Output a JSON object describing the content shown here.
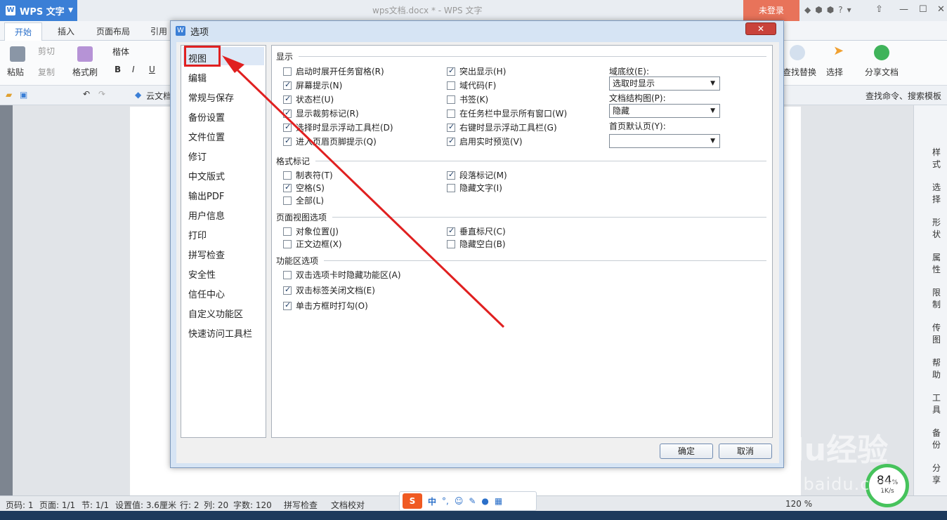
{
  "app": {
    "name": "WPS 文字",
    "logo": "W",
    "doc_title": "wps文档.docx * - WPS 文字",
    "login": "未登录"
  },
  "ribbon_tabs": [
    "开始",
    "插入",
    "页面布局",
    "引用"
  ],
  "ribbon": {
    "paste": "粘贴",
    "cut": "剪切",
    "copy": "复制",
    "format_painter": "格式刷",
    "font_name": "楷体",
    "find_replace": "查找替换",
    "select": "选择",
    "share": "分享文档",
    "cloud_doc": "云文档",
    "search_command": "查找命令、搜索模板"
  },
  "right_panel": [
    "样式",
    "选择",
    "形状",
    "属性",
    "限制",
    "传图",
    "帮助",
    "工具",
    "备份",
    "分享"
  ],
  "status": {
    "page_no": "页码: 1",
    "page_count": "页面: 1/1",
    "section": "节: 1/1",
    "setting": "设置值: 3.6厘米",
    "row": "行: 2",
    "col": "列: 20",
    "words": "字数: 120",
    "spell": "拼写检查",
    "proof": "文档校对",
    "zoom": "120 %"
  },
  "ime": {
    "logo": "S",
    "mode": "中"
  },
  "net": {
    "percent": "84",
    "unit": "%",
    "speed": "1K/s"
  },
  "watermark": {
    "main": "Baidu经验",
    "url": "jingyan.baidu.com"
  },
  "dialog": {
    "title": "选项",
    "logo": "W",
    "nav_items": [
      "视图",
      "编辑",
      "常规与保存",
      "备份设置",
      "文件位置",
      "修订",
      "中文版式",
      "输出PDF",
      "用户信息",
      "打印",
      "拼写检查",
      "安全性",
      "信任中心",
      "自定义功能区",
      "快速访问工具栏"
    ],
    "selected_nav": "视图",
    "sections": {
      "display": "显示",
      "format_marks": "格式标记",
      "page_view": "页面视图选项",
      "ribbon_options": "功能区选项"
    },
    "display_col1": [
      {
        "label": "启动时展开任务窗格(R)",
        "checked": false
      },
      {
        "label": "屏幕提示(N)",
        "checked": true
      },
      {
        "label": "状态栏(U)",
        "checked": true
      },
      {
        "label": "显示裁剪标记(R)",
        "checked": true
      },
      {
        "label": "选择时显示浮动工具栏(D)",
        "checked": true
      },
      {
        "label": "进入页眉页脚提示(Q)",
        "checked": true
      }
    ],
    "display_col2": [
      {
        "label": "突出显示(H)",
        "checked": true
      },
      {
        "label": "域代码(F)",
        "checked": false
      },
      {
        "label": "书签(K)",
        "checked": false
      },
      {
        "label": "在任务栏中显示所有窗口(W)",
        "checked": false
      },
      {
        "label": "右键时显示浮动工具栏(G)",
        "checked": true
      },
      {
        "label": "启用实时预览(V)",
        "checked": true
      }
    ],
    "field_shading_label": "域底纹(E):",
    "field_shading_value": "选取时显示",
    "doc_map_label": "文档结构图(P):",
    "doc_map_value": "隐藏",
    "default_page_label": "首页默认页(Y):",
    "default_page_value": "",
    "format_col1": [
      {
        "label": "制表符(T)",
        "checked": false
      },
      {
        "label": "空格(S)",
        "checked": true
      },
      {
        "label": "全部(L)",
        "checked": false
      }
    ],
    "format_col2": [
      {
        "label": "段落标记(M)",
        "checked": true
      },
      {
        "label": "隐藏文字(I)",
        "checked": false
      }
    ],
    "page_view_col1": [
      {
        "label": "对象位置(J)",
        "checked": false
      },
      {
        "label": "正文边框(X)",
        "checked": false
      }
    ],
    "page_view_col2": [
      {
        "label": "垂直标尺(C)",
        "checked": true
      },
      {
        "label": "隐藏空白(B)",
        "checked": false
      }
    ],
    "ribbon_opts": [
      {
        "label": "双击选项卡时隐藏功能区(A)",
        "checked": false
      },
      {
        "label": "双击标签关闭文档(E)",
        "checked": true
      },
      {
        "label": "单击方框时打勾(O)",
        "checked": true
      }
    ],
    "ok": "确定",
    "cancel": "取消"
  },
  "colors": {
    "annotation": "#e02020",
    "accent": "#3b7fd6"
  }
}
